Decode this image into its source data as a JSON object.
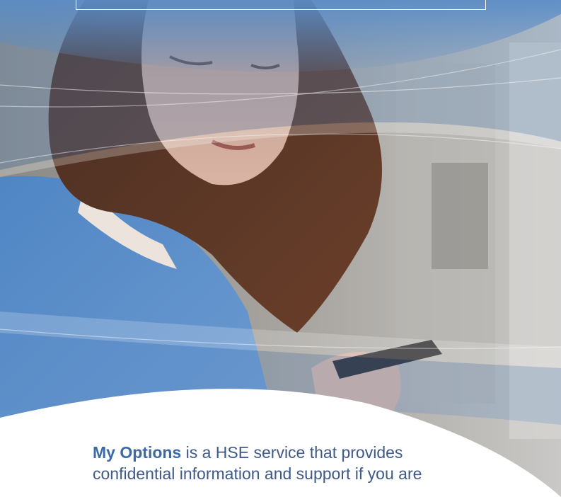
{
  "intro": {
    "brand": "My Options",
    "line1_rest": " is a HSE service that provides",
    "line2": "confidential information and support if you are"
  },
  "colors": {
    "brand_blue": "#3a6aaa",
    "text_blue": "#3f5a88",
    "overlay_blue": "#4f86c4"
  }
}
